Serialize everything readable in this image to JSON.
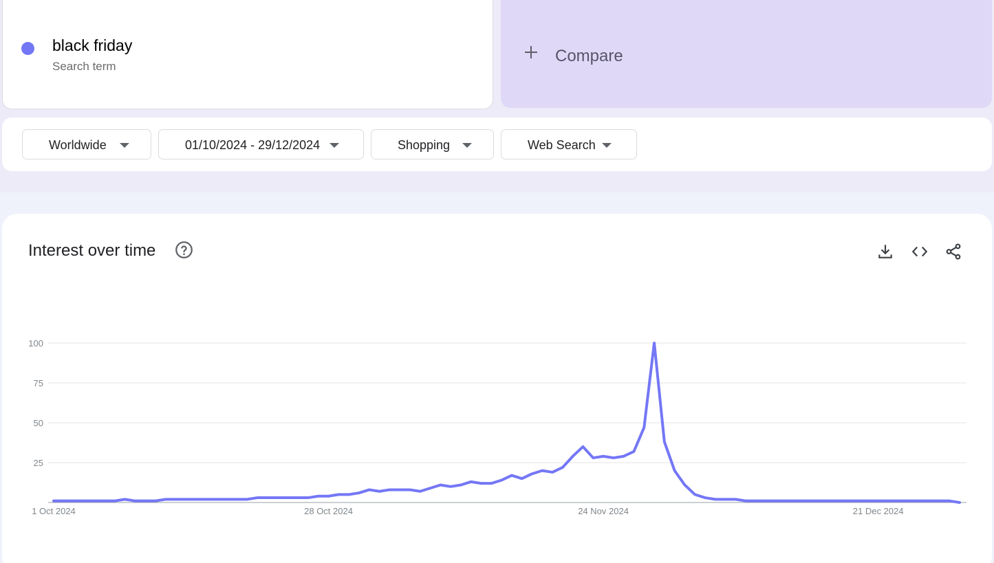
{
  "term": {
    "name": "black friday",
    "type": "Search term",
    "color": "#7477f5"
  },
  "compare": {
    "label": "Compare",
    "icon": "plus-icon"
  },
  "filters": {
    "region": "Worldwide",
    "date_range": "01/10/2024 - 29/12/2024",
    "category": "Shopping",
    "search_type": "Web Search",
    "icon": "dropdown-arrow-icon"
  },
  "panel": {
    "title": "Interest over time",
    "icons": [
      "help-icon",
      "download-icon",
      "embed-code-icon",
      "share-icon"
    ]
  },
  "chart_data": {
    "type": "line",
    "title": "",
    "xlabel": "",
    "ylabel": "",
    "ylim": [
      0,
      100
    ],
    "yticks": [
      25,
      50,
      75,
      100
    ],
    "xtick_labels": [
      "1 Oct 2024",
      "28 Oct 2024",
      "24 Nov 2024",
      "21 Dec 2024"
    ],
    "x_start": "2024-10-01",
    "x_end": "2024-12-29",
    "grid": true,
    "series": [
      {
        "color": "#7477f5",
        "values": [
          1,
          1,
          1,
          1,
          1,
          1,
          1,
          2,
          1,
          1,
          1,
          2,
          2,
          2,
          2,
          2,
          2,
          2,
          2,
          2,
          3,
          3,
          3,
          3,
          3,
          3,
          4,
          4,
          5,
          5,
          6,
          8,
          7,
          8,
          8,
          8,
          7,
          9,
          11,
          10,
          11,
          13,
          12,
          12,
          14,
          17,
          15,
          18,
          20,
          19,
          22,
          29,
          35,
          28,
          29,
          28,
          29,
          32,
          47,
          100,
          38,
          20,
          11,
          5,
          3,
          2,
          2,
          2,
          1,
          1,
          1,
          1,
          1,
          1,
          1,
          1,
          1,
          1,
          1,
          1,
          1,
          1,
          1,
          1,
          1,
          1,
          1,
          1,
          1,
          0
        ]
      }
    ]
  }
}
